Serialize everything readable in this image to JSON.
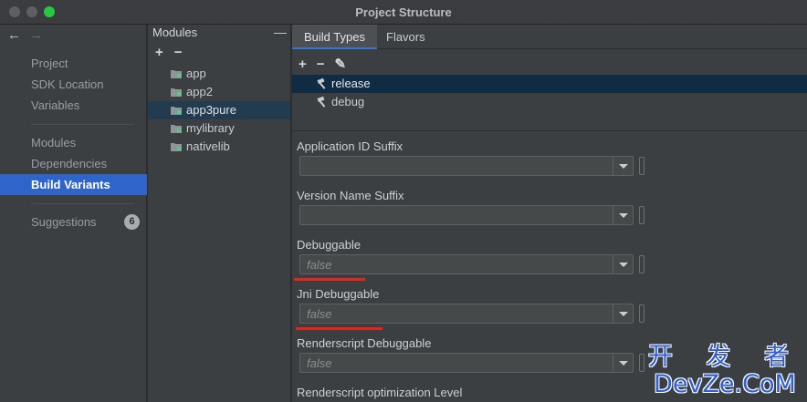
{
  "window": {
    "title": "Project Structure"
  },
  "nav": {
    "back_icon": "←",
    "forward_icon": "→",
    "items": [
      {
        "label": "Project"
      },
      {
        "label": "SDK Location"
      },
      {
        "label": "Variables"
      },
      {
        "label": "Modules"
      },
      {
        "label": "Dependencies"
      },
      {
        "label": "Build Variants"
      },
      {
        "label": "Suggestions",
        "badge": "6"
      }
    ],
    "active": "Build Variants"
  },
  "modules": {
    "header": "Modules",
    "collapse_icon": "—",
    "add_icon": "+",
    "remove_icon": "−",
    "items": [
      {
        "label": "app",
        "icon": "android-module-icon"
      },
      {
        "label": "app2",
        "icon": "android-module-icon"
      },
      {
        "label": "app3pure",
        "icon": "android-module-icon"
      },
      {
        "label": "mylibrary",
        "icon": "library-module-icon"
      },
      {
        "label": "nativelib",
        "icon": "library-module-icon"
      }
    ],
    "selected": "app3pure"
  },
  "tabs": [
    {
      "label": "Build Types"
    },
    {
      "label": "Flavors"
    }
  ],
  "build_types": {
    "add_icon": "+",
    "remove_icon": "−",
    "edit_icon": "✎",
    "items": [
      {
        "label": "release"
      },
      {
        "label": "debug"
      }
    ],
    "selected": "release"
  },
  "properties": [
    {
      "label": "Application ID Suffix",
      "value": ""
    },
    {
      "label": "Version Name Suffix",
      "value": ""
    },
    {
      "label": "Debuggable",
      "value": "false"
    },
    {
      "label": "Jni Debuggable",
      "value": "false"
    },
    {
      "label": "Renderscript Debuggable",
      "value": "false"
    },
    {
      "label": "Renderscript optimization Level",
      "value": ""
    }
  ],
  "colors": {
    "accent": "#2f65ca",
    "selection": "#223b4f",
    "annotation_red": "#e8231a",
    "watermark": "#2f5fd7"
  },
  "watermark": {
    "line1": "开 发 者",
    "line2": "DevZe.CoM"
  }
}
